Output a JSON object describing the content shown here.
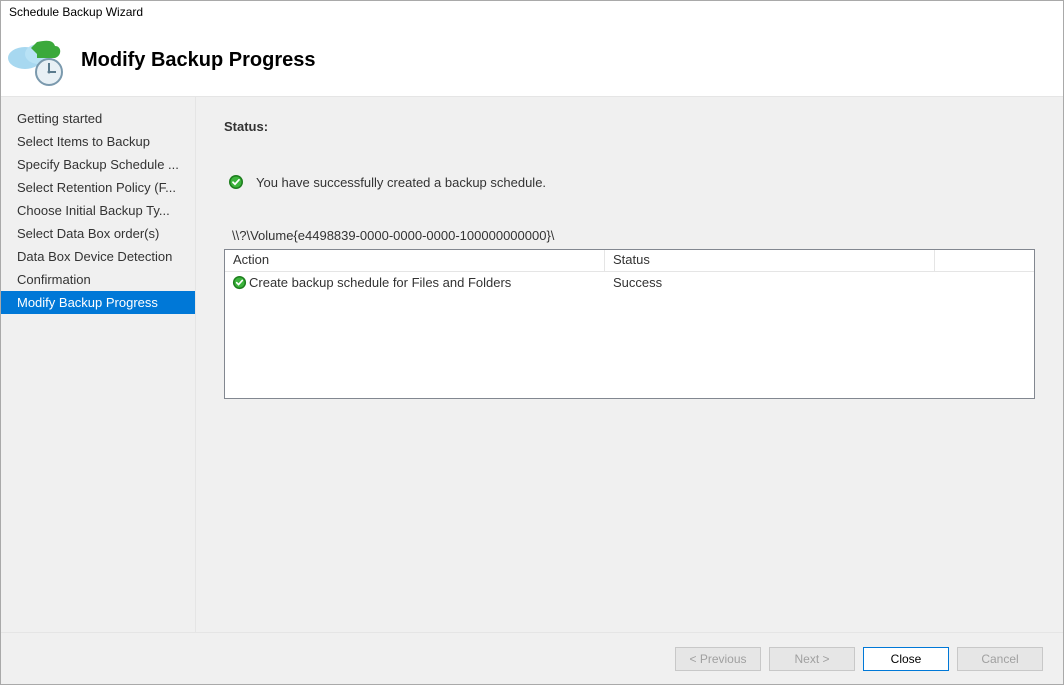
{
  "window": {
    "title": "Schedule Backup Wizard"
  },
  "header": {
    "title": "Modify Backup Progress"
  },
  "sidebar": {
    "items": [
      {
        "label": "Getting started"
      },
      {
        "label": "Select Items to Backup"
      },
      {
        "label": "Specify Backup Schedule ..."
      },
      {
        "label": "Select Retention Policy (F..."
      },
      {
        "label": "Choose Initial Backup Ty..."
      },
      {
        "label": "Select Data Box order(s)"
      },
      {
        "label": "Data Box Device Detection"
      },
      {
        "label": "Confirmation"
      },
      {
        "label": "Modify Backup Progress"
      }
    ],
    "selectedIndex": 8
  },
  "content": {
    "statusLabel": "Status:",
    "successMessage": "You have successfully created a backup schedule.",
    "volumePath": "\\\\?\\Volume{e4498839-0000-0000-0000-100000000000}\\",
    "columns": {
      "action": "Action",
      "status": "Status"
    },
    "rows": [
      {
        "action": "Create backup schedule for Files and Folders",
        "status": "Success"
      }
    ]
  },
  "footer": {
    "previous": "< Previous",
    "next": "Next >",
    "close": "Close",
    "cancel": "Cancel"
  }
}
